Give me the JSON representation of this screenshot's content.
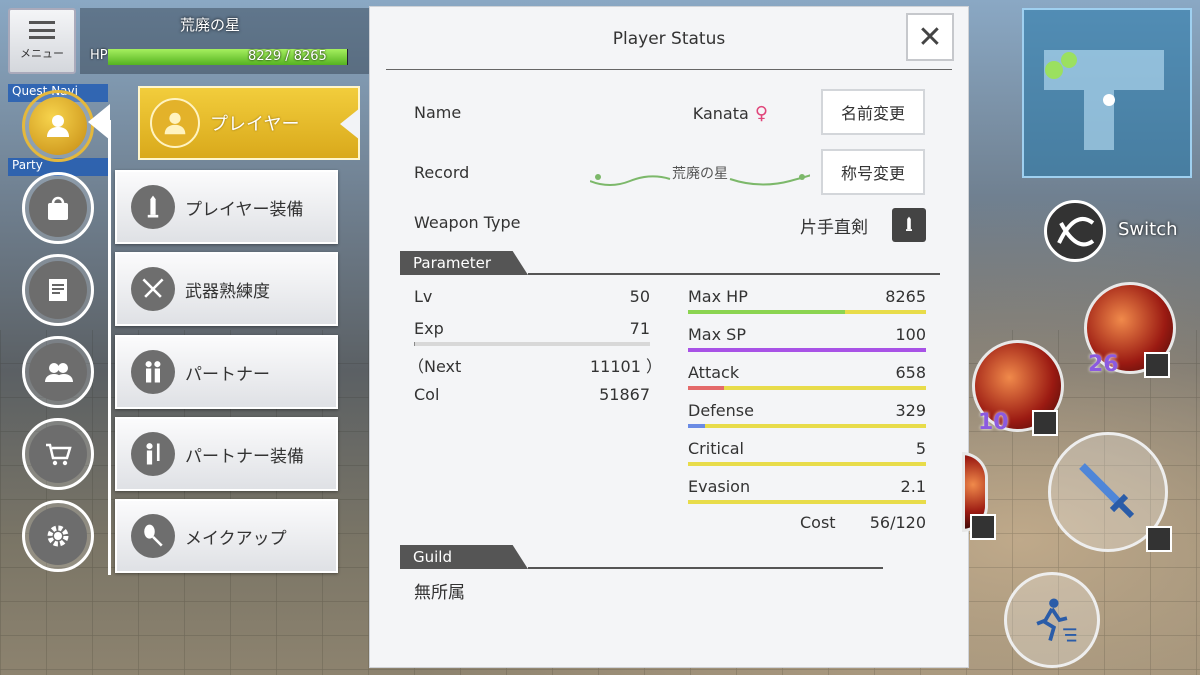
{
  "hud": {
    "menu_label": "メニュー",
    "location": "荒廃の星",
    "hp_label": "HP",
    "hp_text": "8229 / 8265",
    "hp_fraction": 0.9956,
    "quest_label": "Quest Navi",
    "party_label": "Party"
  },
  "side_icons": [
    {
      "name": "player-icon"
    },
    {
      "name": "bag-icon"
    },
    {
      "name": "notes-icon"
    },
    {
      "name": "party-icon"
    },
    {
      "name": "shop-cart-icon"
    },
    {
      "name": "settings-gear-icon"
    }
  ],
  "submenu": {
    "active": "プレイヤー",
    "items": [
      "プレイヤー装備",
      "武器熟練度",
      "パートナー",
      "パートナー装備",
      "メイクアップ"
    ]
  },
  "panel": {
    "title": "Player Status",
    "close": "✕",
    "name_label": "Name",
    "name_value": "Kanata",
    "gender_symbol": "♀",
    "rename_button": "名前変更",
    "record_label": "Record",
    "record_title": "荒廃の星",
    "title_button": "称号変更",
    "weapon_label": "Weapon Type",
    "weapon_value": "片手直剣",
    "parameter_head": "Parameter",
    "left_stats": [
      {
        "label": "Lv",
        "value": "50"
      },
      {
        "label": "Exp",
        "value": "71"
      },
      {
        "label": "（Next",
        "value": "11101 ）"
      },
      {
        "label": "Col",
        "value": "51867"
      }
    ],
    "exp_fraction": 0.006,
    "right_stats": [
      {
        "label": "Max HP",
        "value": "8265",
        "fraction": 0.66,
        "color": "#8bd451"
      },
      {
        "label": "Max SP",
        "value": "100",
        "fraction": 1.0,
        "color": "#a852e6"
      },
      {
        "label": "Attack",
        "value": "658",
        "fraction": 0.15,
        "color": "#e46a6a"
      },
      {
        "label": "Defense",
        "value": "329",
        "fraction": 0.07,
        "color": "#6a8be4"
      },
      {
        "label": "Critical",
        "value": "5",
        "fraction": 0.0,
        "color": "#e8dc4a"
      },
      {
        "label": "Evasion",
        "value": "2.1",
        "fraction": 0.0,
        "color": "#e8dc4a"
      }
    ],
    "cost_label": "Cost",
    "cost_value": "56/120",
    "guild_head": "Guild",
    "guild_value": "無所属"
  },
  "right_hud": {
    "switch_label": "Switch",
    "skill1_count": "26",
    "skill2_count": "10"
  }
}
